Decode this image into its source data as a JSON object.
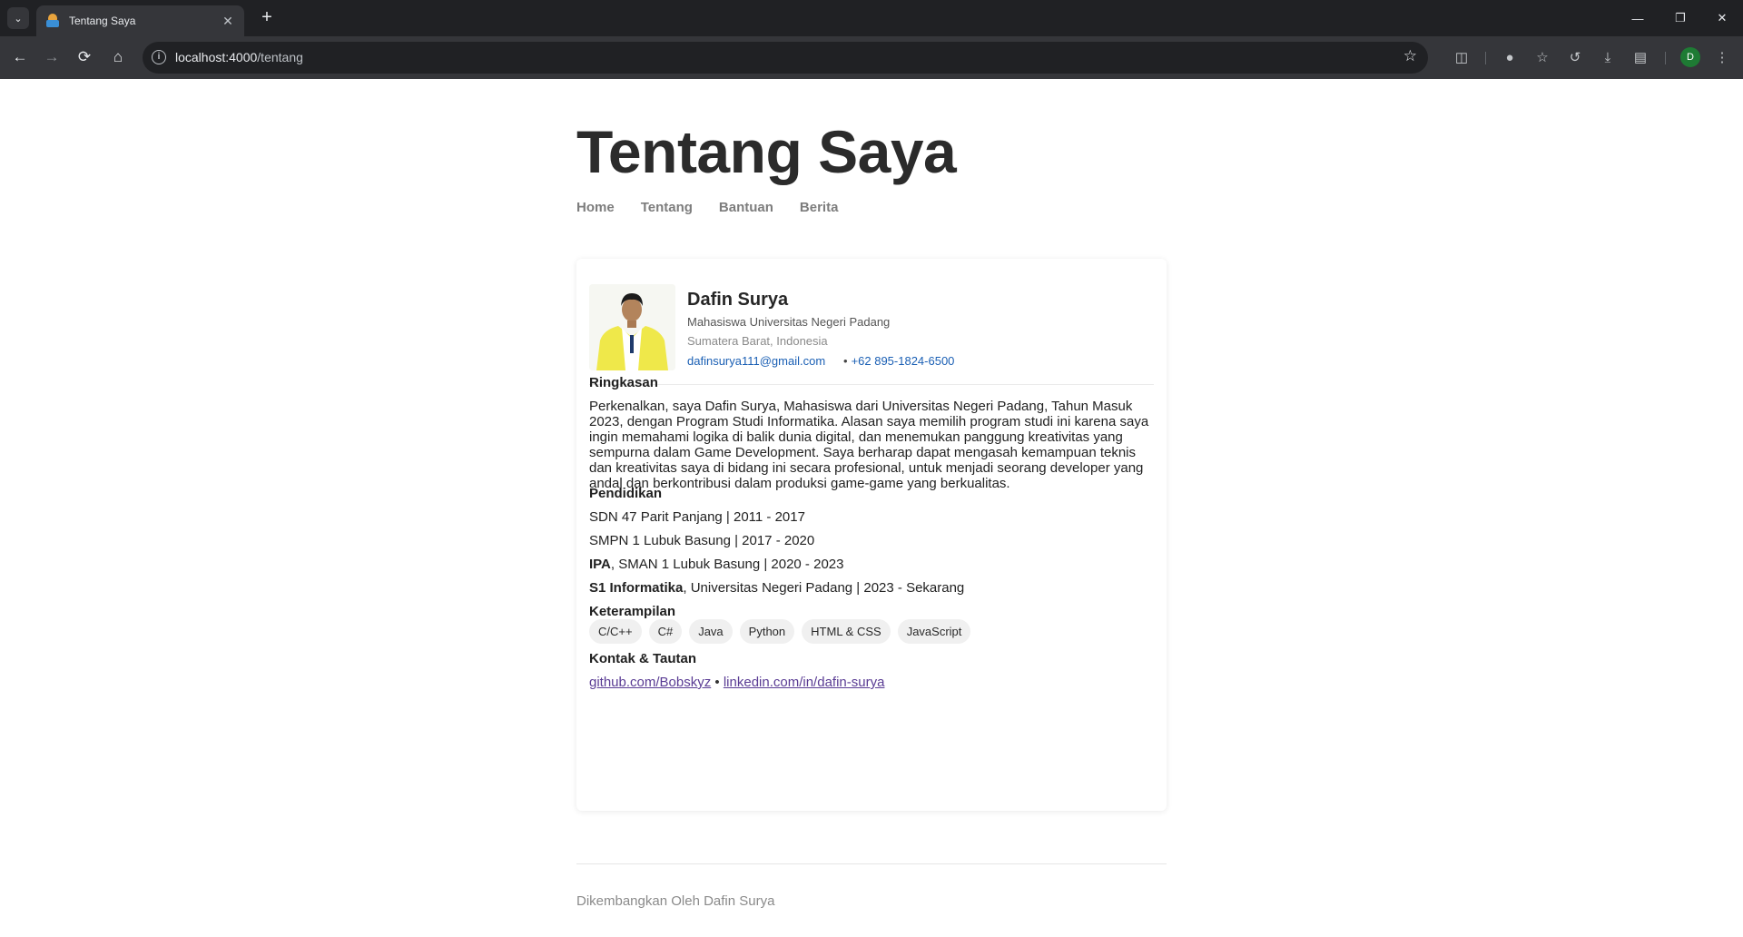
{
  "browser": {
    "tab_title": "Tentang Saya",
    "url_host": "localhost:4000",
    "url_path": "/tentang",
    "profile_initial": "D"
  },
  "site": {
    "title": "Tentang Saya",
    "nav": [
      "Home",
      "Tentang",
      "Bantuan",
      "Berita"
    ]
  },
  "profile": {
    "name": "Dafin Surya",
    "role": "Mahasiswa Universitas Negeri Padang",
    "location": "Sumatera Barat, Indonesia",
    "email": "dafinsurya111@gmail.com",
    "phone_separator": "•",
    "phone": "+62 895-1824-6500"
  },
  "ringkasan": {
    "title": "Ringkasan",
    "text": "Perkenalkan, saya Dafin Surya, Mahasiswa dari Universitas Negeri Padang, Tahun Masuk 2023, dengan Program Studi Informatika. Alasan saya memilih program studi ini karena saya ingin memahami logika di balik dunia digital, dan menemukan panggung kreativitas yang sempurna dalam Game Development. Saya berharap dapat mengasah kemampuan teknis dan kreativitas saya di bidang ini secara profesional, untuk menjadi seorang developer yang andal dan berkontribusi dalam produksi game-game yang berkualitas."
  },
  "pendidikan": {
    "title": "Pendidikan",
    "items": [
      {
        "bold": "",
        "text": "SDN 47 Parit Panjang | 2011 - 2017"
      },
      {
        "bold": "",
        "text": "SMPN 1 Lubuk Basung | 2017 - 2020"
      },
      {
        "bold": "IPA",
        "text": ", SMAN 1 Lubuk Basung | 2020 - 2023"
      },
      {
        "bold": "S1 Informatika",
        "text": ", Universitas Negeri Padang | 2023 - Sekarang"
      }
    ]
  },
  "keterampilan": {
    "title": "Keterampilan",
    "skills": [
      "C/C++",
      "C#",
      "Java",
      "Python",
      "HTML & CSS",
      "JavaScript"
    ]
  },
  "kontak": {
    "title": "Kontak & Tautan",
    "github": "github.com/Bobskyz",
    "separator": "•",
    "linkedin": "linkedin.com/in/dafin-surya"
  },
  "footer": {
    "text": "Dikembangkan Oleh Dafin Surya"
  }
}
